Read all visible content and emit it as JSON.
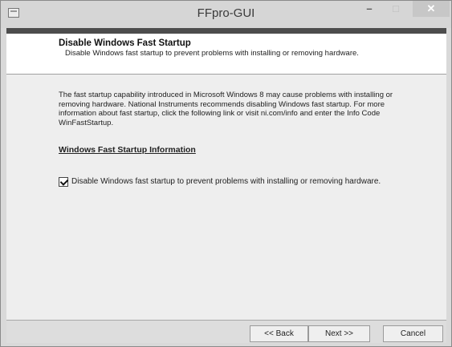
{
  "window": {
    "title": "FFpro-GUI",
    "minimize_glyph": "–",
    "maximize_glyph": "□",
    "close_glyph": "✕"
  },
  "header": {
    "title": "Disable Windows Fast Startup",
    "description": "Disable Windows fast startup to prevent problems with installing or removing hardware."
  },
  "body": {
    "paragraph": "The fast startup capability introduced in Microsoft Windows 8 may cause problems with installing or removing hardware. National Instruments recommends disabling Windows fast startup. For more information about fast startup, click the following link or visit ni.com/info and enter the Info Code WinFastStartup.",
    "link_text": "Windows Fast Startup Information",
    "checkbox_label": "Disable Windows fast startup to prevent problems with installing or removing hardware.",
    "checkbox_checked": true
  },
  "buttons": {
    "back": "<< Back",
    "next": "Next >>",
    "cancel": "Cancel"
  },
  "icons": {
    "app": "window-app-icon",
    "check": "checkmark-icon"
  }
}
